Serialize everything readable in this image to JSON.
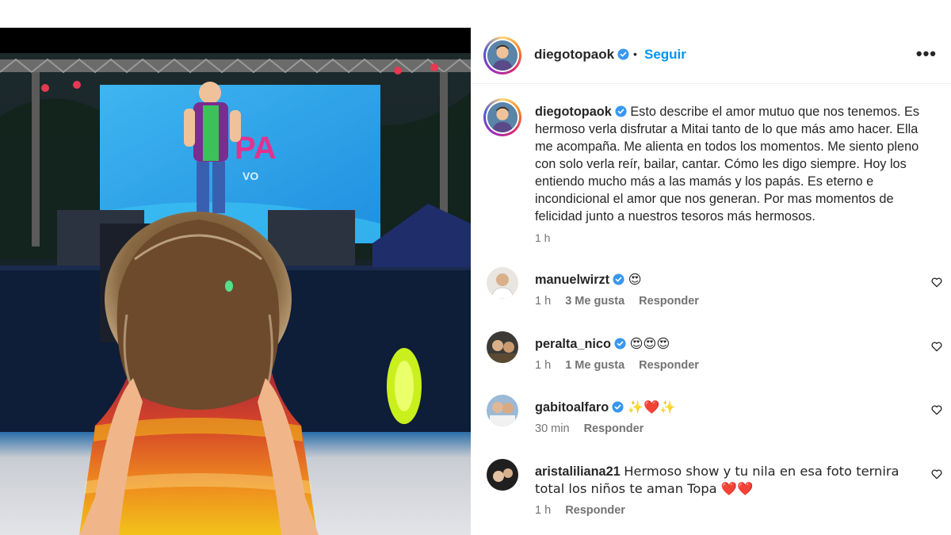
{
  "post": {
    "username": "diegotopaok",
    "follow_label": "Seguir",
    "separator": "•",
    "more_label": "•••",
    "caption": "Esto describe el amor mutuo que nos tenemos. Es hermoso verla disfrutar a Mitai tanto de lo que más amo hacer. Ella me acompaña. Me alienta en todos los momentos. Me siento pleno con solo verla reír, bailar, cantar. Cómo les digo siempre. Hoy los entiendo mucho más a las mamás y los papás. Es eterno e incondicional el amor que nos generan. Por mas momentos de felicidad junto a nuestros tesoros más hermosos.",
    "time": "1 h"
  },
  "media": {
    "stage_text": "PA",
    "stage_subtext": "VO"
  },
  "comments": [
    {
      "username": "manuelwirzt",
      "verified": true,
      "text": "😍",
      "time": "1 h",
      "likes": "3 Me gusta",
      "reply": "Responder"
    },
    {
      "username": "peralta_nico",
      "verified": true,
      "text": "😍😍😍",
      "time": "1 h",
      "likes": "1 Me gusta",
      "reply": "Responder"
    },
    {
      "username": "gabitoalfaro",
      "verified": true,
      "text": "✨❤️✨",
      "time": "30 min",
      "reply": "Responder"
    },
    {
      "username": "aristaliliana21",
      "verified": false,
      "text": "Hermoso show y tu nila en esa foto ternira total los niños te aman Topa ❤️❤️",
      "time": "1 h",
      "reply": "Responder"
    }
  ],
  "colors": {
    "accent": "#0095f6",
    "secondary_text": "#737373",
    "verified_badge": "#3897f0",
    "stage_screen": "#2aa7e8",
    "stage_letters": "#e0338f"
  }
}
